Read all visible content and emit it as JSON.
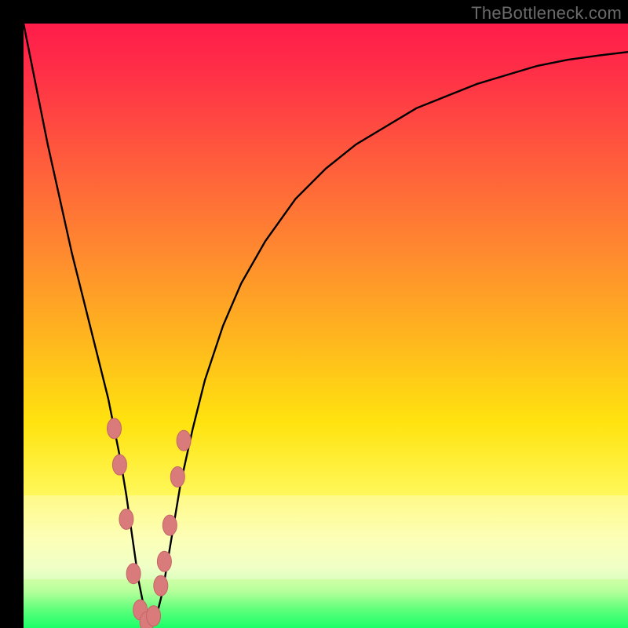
{
  "watermark": "TheBottleneck.com",
  "colors": {
    "curve": "#000000",
    "marker_fill": "#d97a7b",
    "marker_stroke": "#c46668",
    "gradient_top": "#ff1c4a",
    "gradient_bottom": "#1aff69",
    "frame": "#000000"
  },
  "chart_data": {
    "type": "line",
    "title": "",
    "xlabel": "",
    "ylabel": "",
    "xlim": [
      0,
      100
    ],
    "ylim": [
      0,
      100
    ],
    "grid": false,
    "legend": false,
    "series": [
      {
        "name": "bottleneck-curve",
        "x": [
          0,
          2,
          4,
          6,
          8,
          10,
          12,
          14,
          15,
          16,
          17,
          18,
          19,
          20,
          21,
          22,
          23,
          24,
          25,
          26,
          28,
          30,
          33,
          36,
          40,
          45,
          50,
          55,
          60,
          65,
          70,
          75,
          80,
          85,
          90,
          95,
          100
        ],
        "y": [
          100,
          90,
          80,
          71,
          62,
          54,
          46,
          38,
          33,
          28,
          22,
          15,
          8,
          3,
          0.5,
          2,
          6,
          12,
          18,
          24,
          33,
          41,
          50,
          57,
          64,
          71,
          76,
          80,
          83,
          86,
          88,
          90,
          91.5,
          93,
          94,
          94.7,
          95.3
        ]
      }
    ],
    "markers": {
      "name": "highlight-points",
      "x": [
        15.0,
        15.9,
        17.0,
        18.2,
        19.3,
        20.4,
        21.5,
        22.7,
        23.3,
        24.2,
        25.5,
        26.5
      ],
      "y": [
        33.0,
        27.0,
        18.0,
        9.0,
        3.0,
        1.0,
        2.0,
        7.0,
        11.0,
        17.0,
        25.0,
        31.0
      ]
    }
  }
}
